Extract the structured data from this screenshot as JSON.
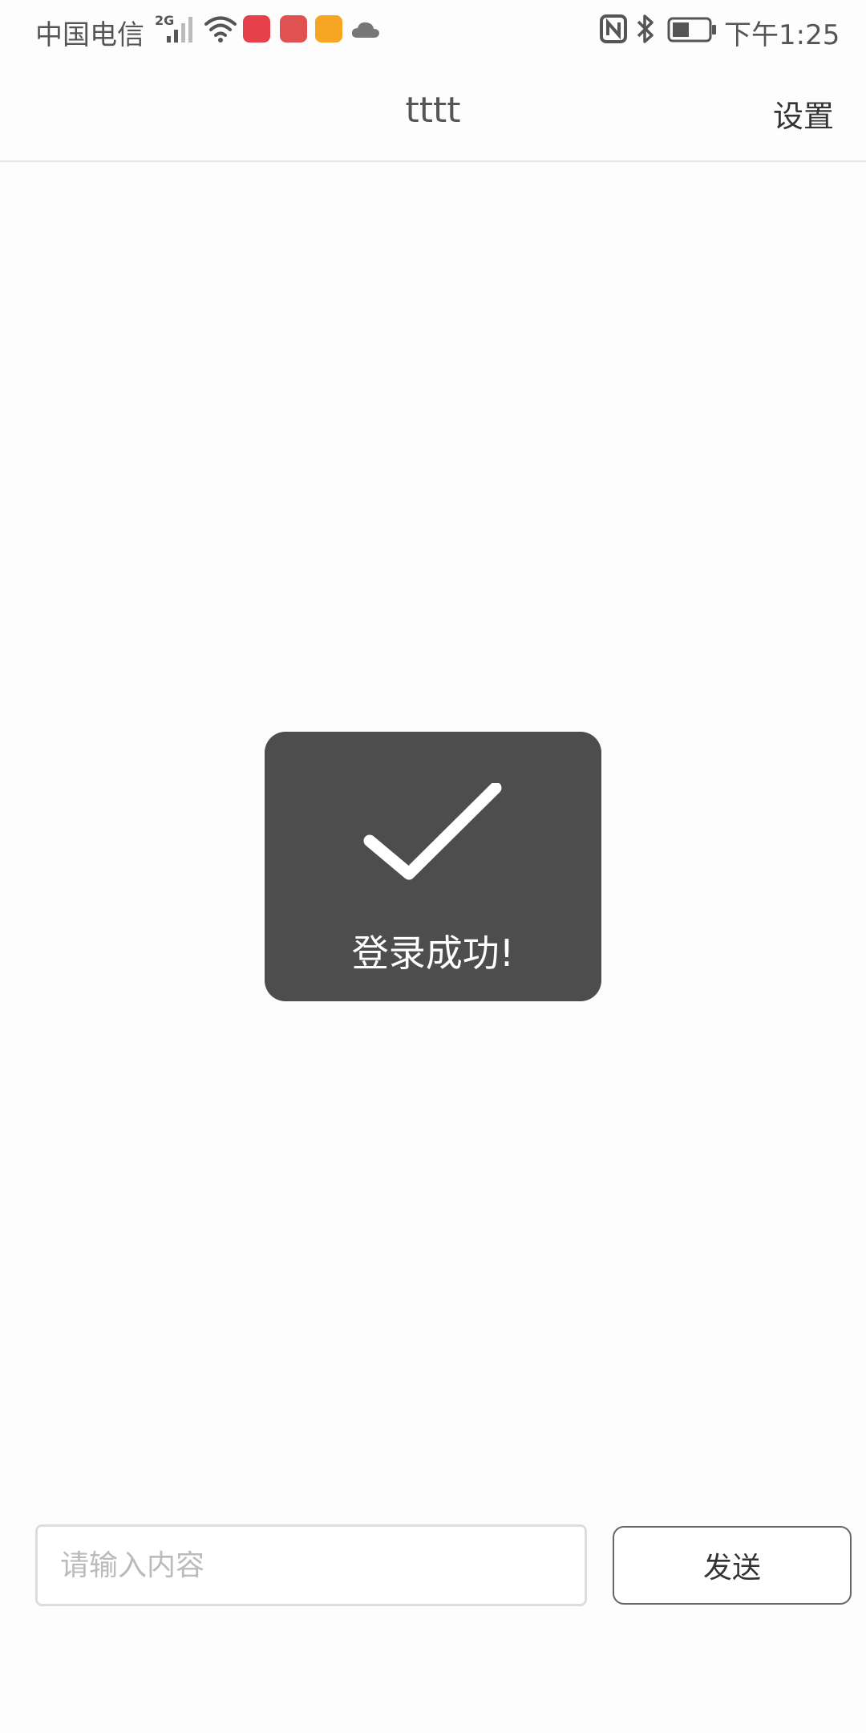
{
  "status_bar": {
    "carrier": "中国电信",
    "network_type": "2G",
    "time": "下午1:25",
    "icons": [
      "signal-icon",
      "wifi-icon",
      "appgallery-icon",
      "books-icon",
      "notes-icon",
      "cloud-icon",
      "nfc-icon",
      "bluetooth-icon",
      "battery-icon"
    ]
  },
  "header": {
    "title": "tttt",
    "settings_label": "设置"
  },
  "toast": {
    "icon": "check-icon",
    "message": "登录成功!",
    "background": "#4d4d4d"
  },
  "composer": {
    "input_value": "",
    "input_placeholder": "请输入内容",
    "send_label": "发送"
  }
}
